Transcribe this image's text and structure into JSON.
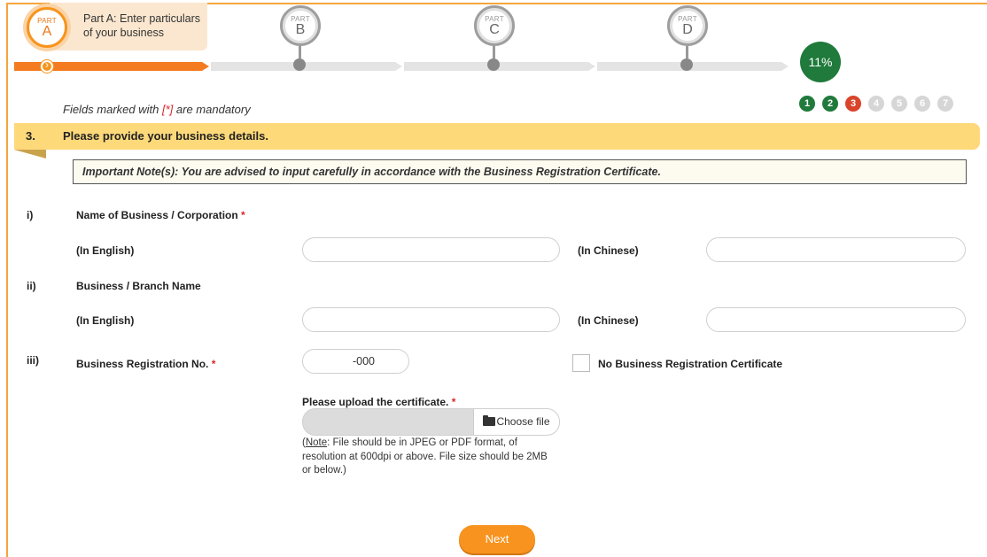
{
  "progress": {
    "parts": [
      {
        "small": "PART",
        "letter": "A",
        "active": true
      },
      {
        "small": "PART",
        "letter": "B",
        "active": false
      },
      {
        "small": "PART",
        "letter": "C",
        "active": false
      },
      {
        "small": "PART",
        "letter": "D",
        "active": false
      }
    ],
    "part_a_caption": "Part A: Enter particulars of your business",
    "percent": "11%",
    "percent_value": 0.11
  },
  "mandatory": {
    "prefix": "Fields marked with ",
    "marker": "[*]",
    "suffix": " are mandatory"
  },
  "steps": [
    {
      "label": "1",
      "state": "done"
    },
    {
      "label": "2",
      "state": "done"
    },
    {
      "label": "3",
      "state": "current"
    },
    {
      "label": "4",
      "state": "pending"
    },
    {
      "label": "5",
      "state": "pending"
    },
    {
      "label": "6",
      "state": "pending"
    },
    {
      "label": "7",
      "state": "pending"
    }
  ],
  "section": {
    "number": "3.",
    "title": "Please provide your business details."
  },
  "note": "Important Note(s): You are advised to input carefully in accordance with the Business Registration Certificate.",
  "fields": {
    "name": {
      "roman": "i)",
      "label": "Name of Business / Corporation",
      "required": "*",
      "english_label": "(In English)",
      "chinese_label": "(In Chinese)",
      "english_value": "",
      "chinese_value": ""
    },
    "branch": {
      "roman": "ii)",
      "label": "Business / Branch Name",
      "english_label": "(In English)",
      "chinese_label": "(In Chinese)",
      "english_value": "",
      "chinese_value": ""
    },
    "br_no": {
      "roman": "iii)",
      "label": "Business Registration No.",
      "required": "*",
      "value": "-000",
      "no_cert_label": "No Business Registration Certificate"
    }
  },
  "upload": {
    "label": "Please upload the certificate.",
    "required": "*",
    "choose_label": "Choose file",
    "note_prefix": "(",
    "note_link": "Note",
    "note_text": ": File should be in JPEG or PDF format, of resolution at 600dpi or above. File size should be 2MB or below.)"
  },
  "next_label": "Next",
  "colors": {
    "accent": "#f7931e",
    "done": "#1f7a3b",
    "current": "#d9442b",
    "banner": "#fdd97a"
  }
}
